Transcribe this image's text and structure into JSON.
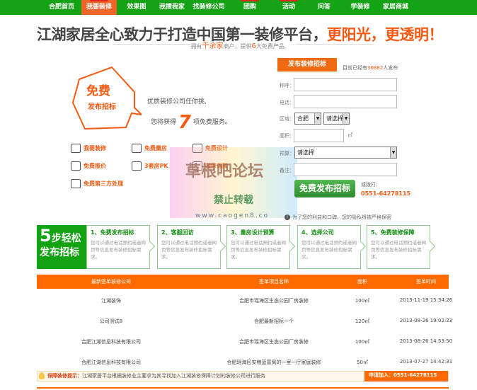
{
  "nav": {
    "items": [
      {
        "label": "合肥首页",
        "badge": false
      },
      {
        "label": "我要装修",
        "badge": true,
        "active": true
      },
      {
        "label": "效果图",
        "badge": false
      },
      {
        "label": "我搜我家",
        "badge": false
      },
      {
        "label": "找装修公司",
        "badge": false
      },
      {
        "label": "团购",
        "badge": true
      },
      {
        "label": "活动",
        "badge": true
      },
      {
        "label": "问答",
        "badge": false
      },
      {
        "label": "学装修",
        "badge": false
      },
      {
        "label": "家居商城",
        "badge": false
      }
    ]
  },
  "headline": {
    "main": "江湖家居全心致力于打造中国第一装修平台，",
    "highlight": "更阳光，更透明！"
  },
  "subline": {
    "p1": "拥有",
    "h1": "千余家",
    "p2": "商户，提供",
    "h2": "6",
    "p3": "大免费产品."
  },
  "promo": {
    "title": "免费",
    "subtitle": "发布招标",
    "pitch1": "优质装修公司任你挑,",
    "pitch2a": "您将获得",
    "pitch2num": "7",
    "pitch2b": "项免费服务。"
  },
  "features": [
    {
      "icon": "eye-icon",
      "label": "我要装修"
    },
    {
      "icon": "ruler-icon",
      "label": "免费量房"
    },
    {
      "icon": "pencil-icon",
      "label": "免费设计"
    },
    {
      "icon": "document-icon",
      "label": "免费报价"
    },
    {
      "icon": "compare-icon",
      "label": "3套房PK"
    },
    {
      "icon": "shield-icon",
      "label": "装修保障"
    },
    {
      "icon": "helmet-icon",
      "label": "免费第三方处理"
    }
  ],
  "form": {
    "tab": "发布装修招标",
    "note_pre": "目前已经有",
    "note_count": "36882",
    "note_post": "人发布",
    "name_label": "称呼：",
    "phone_label": "电话：",
    "region_label": "区域：",
    "city": "合肥",
    "district": "请选择",
    "area_label": "面积：",
    "area_unit": "㎡",
    "budget_label": "预算：",
    "budget": "请选择",
    "remark_label": "备注：",
    "submit": "免费发布招标",
    "call_label": "或拨打：",
    "phone": "0551-64278115",
    "privacy": "为了您的利益和口碑，您的隐私将被严格保密"
  },
  "watermark": {
    "line1": "草根吧论坛",
    "line2": "禁止转载",
    "line3": "www.caogen8.co"
  },
  "steps": {
    "lead_num": "5",
    "lead_a": "步轻松",
    "lead_b": "发布招标",
    "items": [
      {
        "title": "1、免费发布招标",
        "desc": "您可以通过电话预约或者网页等信息发布装修招标需求。"
      },
      {
        "title": "2、客服回访",
        "desc": "您可以通过电话预约或者网页等信息发布装修招标需求。"
      },
      {
        "title": "3、量房设计预算",
        "desc": "您可以通过电话预约或者网页等信息发布装修招标需求。"
      },
      {
        "title": "4、选择公司",
        "desc": "您可以通过电话预约或者网页等信息发布装修招标需求。"
      },
      {
        "title": "5、免费装修保障",
        "desc": "您可以通过电话预约或者网页等信息发布装修招标需求。"
      }
    ]
  },
  "table": {
    "headers": [
      "最新签单装修公司",
      "签单项目名称",
      "面积",
      "签单时间"
    ],
    "rows": [
      [
        "江湖装饰",
        "合肥市瑶海区生态公园厂房装修",
        "100㎡",
        "2013-11-19 15:34:26"
      ],
      [
        "公司测试8",
        "合肥最新招标一个",
        "120㎡",
        "2013-08-26 19:02:23"
      ],
      [
        "合肥江湖信息科技有限公司",
        "合肥市瑶海区生态公园厂房装修",
        "100㎡",
        "2013-08-26 14:53:50"
      ],
      [
        "合肥江湖信息科技有限公司",
        "合肥瑶海区安粮蓝富窝的一室一厅家庭装修",
        "50㎡",
        "2013-07-27 14:42:31"
      ]
    ]
  },
  "tip": {
    "key": "保障装修提示：",
    "text": "江湖家居平台根据装修业主要求为其寻找加入江湖装修保障计划的装修公司进行服务",
    "join": "申请加入：0551-64278115"
  },
  "colors": {
    "green": "#14a314",
    "orange": "#ff6a00",
    "accent": "#f65a12"
  }
}
